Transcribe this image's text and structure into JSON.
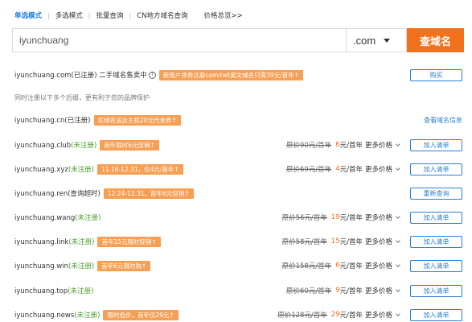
{
  "tabs": {
    "single": "单选模式",
    "multi": "多选模式",
    "bulk": "批量查询",
    "cn": "CN地方域名查询",
    "price": "价格总览>>"
  },
  "search": {
    "value": "iyunchuang",
    "suffix": ".com",
    "button": "查域名"
  },
  "first_row": {
    "domain": "iyunchuang.com(已注册) 二手域名售卖中",
    "help": "?",
    "badge": "新用户领券注册com/net英文域名只需39元/首年↑",
    "button": "购买"
  },
  "note": "同时注册以下多个后缀，更有利于您的品牌保护",
  "cn_row": {
    "domain": "iyunchuang.cn(已注册)",
    "badge": "买域名送云主机20元代金券↑",
    "link": "查看域名信息"
  },
  "rows": [
    {
      "name": "iyunchuang.club",
      "status": "(未注册)",
      "badge": "首年限时6元促销↑",
      "orig": "原价90元/首年",
      "price": "6",
      "unit": "元/首年",
      "more": "更多价格",
      "button": "加入清单"
    },
    {
      "name": "iyunchuang.xyz",
      "status": "(未注册)",
      "badge": "11.16-12.31，仅4元/首年↑",
      "orig": "原价69元/首年",
      "price": "4",
      "unit": "元/首年",
      "more": "更多价格",
      "button": "加入清单"
    },
    {
      "name": "iyunchuang.ren",
      "status": "(查询超时)",
      "badge": "12.24-12.31，首年6元促销↑",
      "orig": "",
      "price": "",
      "unit": "",
      "more": "",
      "button": "重新查询"
    },
    {
      "name": "iyunchuang.wang",
      "status": "(未注册)",
      "badge": "",
      "orig": "原价56元/首年",
      "price": "19",
      "unit": "元/首年",
      "more": "更多价格",
      "button": "加入清单"
    },
    {
      "name": "iyunchuang.link",
      "status": "(未注册)",
      "badge": "首年15元限时促销↑",
      "orig": "原价58元/首年",
      "price": "15",
      "unit": "元/首年",
      "more": "更多价格",
      "button": "加入清单"
    },
    {
      "name": "iyunchuang.win",
      "status": "(未注册)",
      "badge": "首年6元限时购↑",
      "orig": "原价158元/首年",
      "price": "6",
      "unit": "元/首年",
      "more": "更多价格",
      "button": "加入清单"
    },
    {
      "name": "iyunchuang.top",
      "status": "(未注册)",
      "badge": "",
      "orig": "原价60元/首年",
      "price": "9",
      "unit": "元/首年",
      "more": "更多价格",
      "button": "加入清单"
    },
    {
      "name": "iyunchuang.news",
      "status": "(未注册)",
      "badge": "限时低价，首年仅29元↑",
      "orig": "原价128元/首年",
      "price": "29",
      "unit": "元/首年",
      "more": "更多价格",
      "button": "加入清单"
    }
  ]
}
